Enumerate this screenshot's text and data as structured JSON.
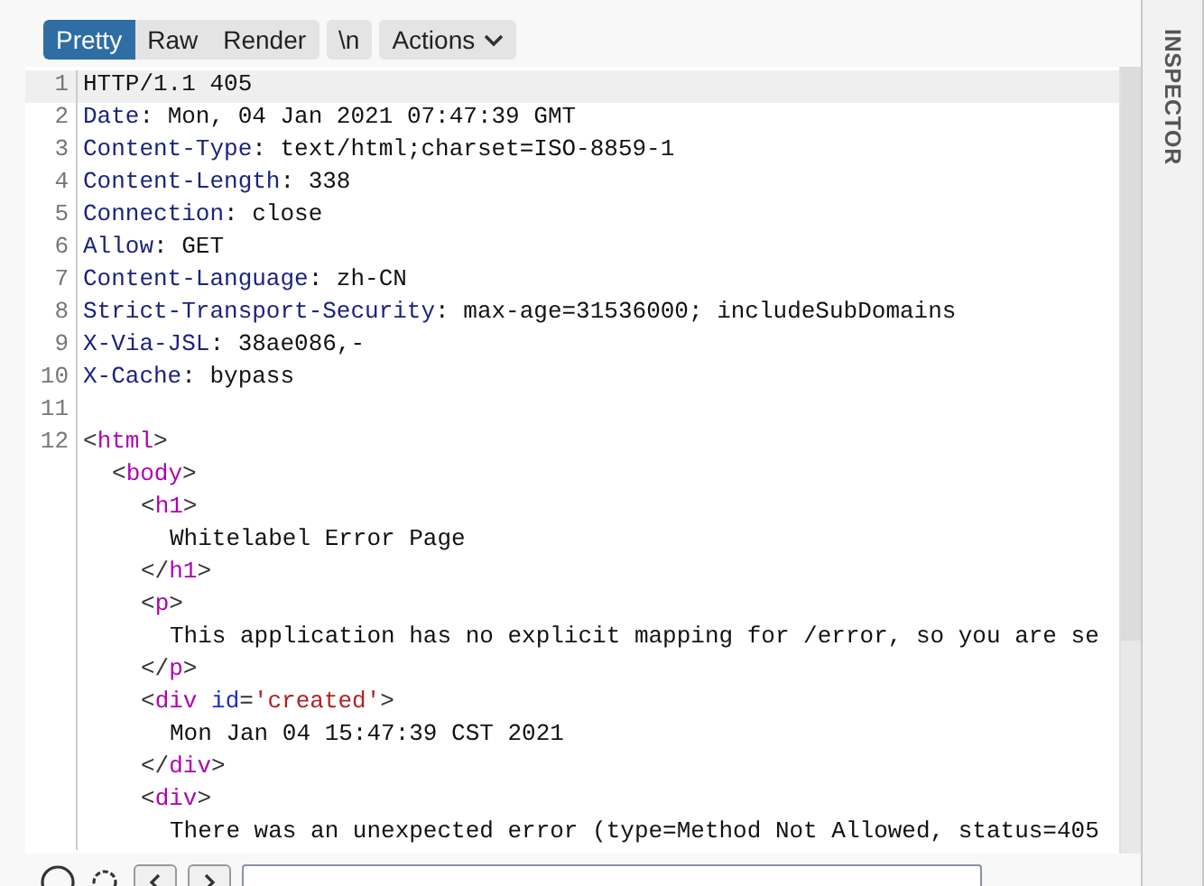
{
  "view_tabs": [
    {
      "label": "Pretty",
      "selected": true
    },
    {
      "label": "Raw",
      "selected": false
    },
    {
      "label": "Render",
      "selected": false
    }
  ],
  "toolbar_buttons": [
    {
      "label": "\\n",
      "kind": "toggle"
    },
    {
      "label": "Actions",
      "kind": "menu"
    }
  ],
  "side_panel": {
    "title": "INSPECTOR"
  },
  "lines": [
    {
      "number": "1",
      "highlighted": true,
      "tokens": [
        {
          "kind": "plain",
          "text": "HTTP/1.1 405"
        }
      ]
    },
    {
      "number": "2",
      "highlighted": false,
      "tokens": [
        {
          "kind": "header",
          "text": "Date"
        },
        {
          "kind": "plain",
          "text": ": Mon, 04 Jan 2021 07:47:39 GMT"
        }
      ]
    },
    {
      "number": "3",
      "highlighted": false,
      "tokens": [
        {
          "kind": "header",
          "text": "Content-Type"
        },
        {
          "kind": "plain",
          "text": ": text/html;charset=ISO-8859-1"
        }
      ]
    },
    {
      "number": "4",
      "highlighted": false,
      "tokens": [
        {
          "kind": "header",
          "text": "Content-Length"
        },
        {
          "kind": "plain",
          "text": ": 338"
        }
      ]
    },
    {
      "number": "5",
      "highlighted": false,
      "tokens": [
        {
          "kind": "header",
          "text": "Connection"
        },
        {
          "kind": "plain",
          "text": ": close"
        }
      ]
    },
    {
      "number": "6",
      "highlighted": false,
      "tokens": [
        {
          "kind": "header",
          "text": "Allow"
        },
        {
          "kind": "plain",
          "text": ": GET"
        }
      ]
    },
    {
      "number": "7",
      "highlighted": false,
      "tokens": [
        {
          "kind": "header",
          "text": "Content-Language"
        },
        {
          "kind": "plain",
          "text": ": zh-CN"
        }
      ]
    },
    {
      "number": "8",
      "highlighted": false,
      "tokens": [
        {
          "kind": "header",
          "text": "Strict-Transport-Security"
        },
        {
          "kind": "plain",
          "text": ": max-age=31536000; includeSubDomains"
        }
      ]
    },
    {
      "number": "9",
      "highlighted": false,
      "tokens": [
        {
          "kind": "header",
          "text": "X-Via-JSL"
        },
        {
          "kind": "plain",
          "text": ": 38ae086,-"
        }
      ]
    },
    {
      "number": "10",
      "highlighted": false,
      "tokens": [
        {
          "kind": "header",
          "text": "X-Cache"
        },
        {
          "kind": "plain",
          "text": ": bypass"
        }
      ]
    },
    {
      "number": "11",
      "highlighted": false
    },
    {
      "number": "12",
      "highlighted": false,
      "tokens": [
        {
          "kind": "punct",
          "text": "<"
        },
        {
          "kind": "tag",
          "text": "html"
        },
        {
          "kind": "punct",
          "text": ">"
        }
      ],
      "children": [
        {
          "highlighted": false,
          "tokens": [
            {
              "kind": "punct",
              "text": "<"
            },
            {
              "kind": "tag",
              "text": "body"
            },
            {
              "kind": "punct",
              "text": ">"
            }
          ],
          "children": [
            {
              "highlighted": false,
              "tokens": [
                {
                  "kind": "punct",
                  "text": "<"
                },
                {
                  "kind": "tag",
                  "text": "h1"
                },
                {
                  "kind": "punct",
                  "text": ">"
                }
              ],
              "children": [
                {
                  "highlighted": false,
                  "tokens": [
                    {
                      "kind": "plain",
                      "text": "Whitelabel Error Page"
                    }
                  ]
                }
              ]
            },
            {
              "highlighted": false,
              "tokens": [
                {
                  "kind": "punct",
                  "text": "</"
                },
                {
                  "kind": "tag",
                  "text": "h1"
                },
                {
                  "kind": "punct",
                  "text": ">"
                }
              ]
            },
            {
              "highlighted": false,
              "tokens": [
                {
                  "kind": "punct",
                  "text": "<"
                },
                {
                  "kind": "tag",
                  "text": "p"
                },
                {
                  "kind": "punct",
                  "text": ">"
                }
              ],
              "children": [
                {
                  "highlighted": false,
                  "tokens": [
                    {
                      "kind": "plain",
                      "text": "This application has no explicit mapping for /error, so you are se"
                    }
                  ]
                }
              ]
            },
            {
              "highlighted": false,
              "tokens": [
                {
                  "kind": "punct",
                  "text": "</"
                },
                {
                  "kind": "tag",
                  "text": "p"
                },
                {
                  "kind": "punct",
                  "text": ">"
                }
              ]
            },
            {
              "highlighted": false,
              "tokens": [
                {
                  "kind": "punct",
                  "text": "<"
                },
                {
                  "kind": "tag",
                  "text": "div"
                },
                {
                  "kind": "attr",
                  "text": " id"
                },
                {
                  "kind": "punct",
                  "text": "="
                },
                {
                  "kind": "string",
                  "text": "'created'"
                },
                {
                  "kind": "punct",
                  "text": ">"
                }
              ],
              "children": [
                {
                  "highlighted": false,
                  "tokens": [
                    {
                      "kind": "plain",
                      "text": "Mon Jan 04 15:47:39 CST 2021"
                    }
                  ]
                }
              ]
            },
            {
              "highlighted": false,
              "tokens": [
                {
                  "kind": "punct",
                  "text": "</"
                },
                {
                  "kind": "tag",
                  "text": "div"
                },
                {
                  "kind": "punct",
                  "text": ">"
                }
              ]
            },
            {
              "highlighted": false,
              "tokens": [
                {
                  "kind": "punct",
                  "text": "<"
                },
                {
                  "kind": "tag",
                  "text": "div"
                },
                {
                  "kind": "punct",
                  "text": ">"
                }
              ],
              "children": [
                {
                  "highlighted": false,
                  "tokens": [
                    {
                      "kind": "plain",
                      "text": "There was an unexpected error (type=Method Not Allowed, status=405"
                    }
                  ]
                }
              ]
            }
          ]
        }
      ]
    }
  ]
}
